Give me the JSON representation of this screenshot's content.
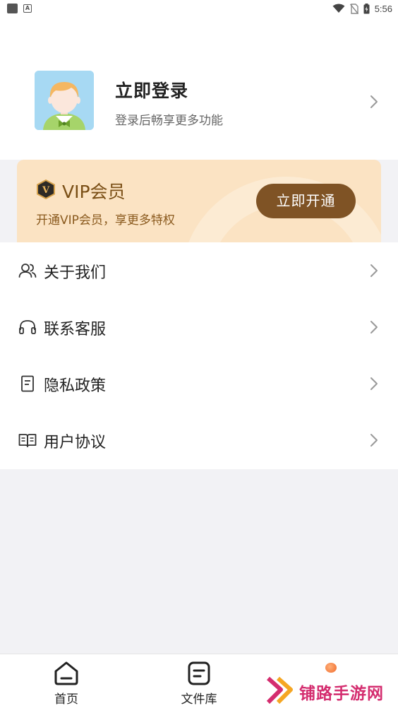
{
  "status_bar": {
    "left_icon_2": "A",
    "time": "5:56",
    "icons": [
      "gallery-icon",
      "accessibility-icon",
      "wifi-icon",
      "no-sim-icon",
      "battery-charging-icon"
    ]
  },
  "profile": {
    "title": "立即登录",
    "subtitle": "登录后畅享更多功能",
    "avatar_icon": "default-avatar-icon",
    "chevron_icon": "chevron-right-icon"
  },
  "vip": {
    "title": "VIP会员",
    "subtitle": "开通VIP会员，享更多特权",
    "button_label": "立即开通",
    "badge_letter": "V",
    "colors": {
      "card_bg": "#fbe3c3",
      "button_bg": "#7f5325",
      "title": "#7a4f16"
    }
  },
  "menu": {
    "items": [
      {
        "label": "关于我们",
        "icon": "users-icon"
      },
      {
        "label": "联系客服",
        "icon": "headset-icon"
      },
      {
        "label": "隐私政策",
        "icon": "document-icon"
      },
      {
        "label": "用户协议",
        "icon": "book-icon"
      }
    ]
  },
  "bottom_nav": {
    "items": [
      {
        "label": "首页",
        "icon": "home-icon"
      },
      {
        "label": "文件库",
        "icon": "file-library-icon"
      },
      {
        "label": "",
        "icon": "profile-tab-icon"
      }
    ]
  },
  "watermark": {
    "text": "铺路手游网",
    "logo_icon": "double-chevron-logo-icon"
  }
}
